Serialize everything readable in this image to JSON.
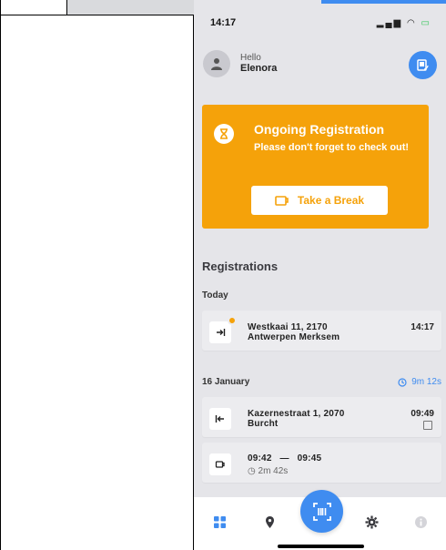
{
  "status_bar": {
    "time": "14:17"
  },
  "user": {
    "greeting": "Hello",
    "name": "Elenora"
  },
  "ongoing": {
    "title": "Ongoing Registration",
    "subtitle": "Please don't forget to check out!",
    "button_label": "Take a Break"
  },
  "registrations": {
    "title": "Registrations",
    "groups": [
      {
        "label": "Today",
        "items": [
          {
            "type": "check-in",
            "address_line1": "Westkaai 11, 2170",
            "address_line2": "Antwerpen Merksem",
            "time": "14:17"
          }
        ]
      },
      {
        "label": "16 January",
        "duration": "9m 12s",
        "items": [
          {
            "type": "check-out",
            "address_line1": "Kazernestraat 1, 2070",
            "address_line2": "Burcht",
            "time": "09:49"
          },
          {
            "type": "break",
            "start": "09:42",
            "dash": "—",
            "end": "09:45",
            "duration": "2m 42s"
          }
        ]
      }
    ]
  },
  "colors": {
    "accent_blue": "#3f8cf0",
    "accent_orange": "#f5a20a",
    "background": "#e5e5e9"
  },
  "nav": {
    "items": [
      "grid-icon",
      "location-pin-icon",
      "barcode-scan-icon",
      "gear-icon",
      "info-icon"
    ],
    "active": "grid-icon"
  }
}
